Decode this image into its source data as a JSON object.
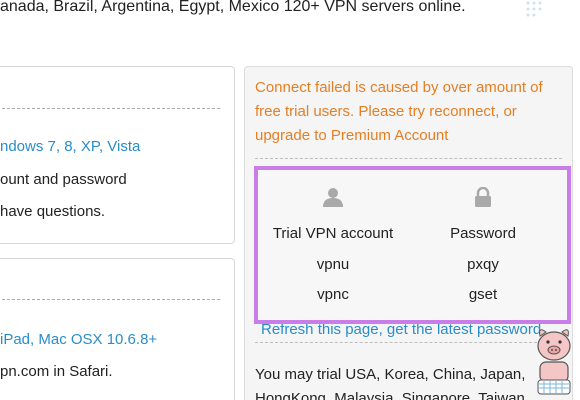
{
  "banner": {
    "text": "anada, Brazil, Argentina, Egypt, Mexico 120+ VPN servers online."
  },
  "card_a": {
    "line1": "ndows 7, 8, XP, Vista",
    "line2": "ount and password",
    "line3": "have questions."
  },
  "card_b": {
    "line1": "iPad, Mac OSX 10.6.8+",
    "line2": "pn.com in Safari."
  },
  "panel": {
    "warning": "Connect failed is caused by over amount of free trial users. Please try reconnect, or upgrade to Premium Account",
    "refresh_link": "Refresh this page, get the latest password",
    "trial_info": "You may trial USA, Korea, China, Japan, HongKong, Malaysia, Singapore, Taiwan"
  },
  "credentials": {
    "account_header": "Trial VPN account",
    "password_header": "Password",
    "rows": [
      {
        "account": "vpnu",
        "password": "pxqy"
      },
      {
        "account": "vpnc",
        "password": "gset"
      }
    ]
  },
  "icons": {
    "account": "user-icon",
    "password": "lock-icon",
    "mascot": "pig-mascot-watermark"
  },
  "colors": {
    "link": "#2a8dc9",
    "warning": "#e67e22",
    "highlight_border": "#c97de8"
  }
}
